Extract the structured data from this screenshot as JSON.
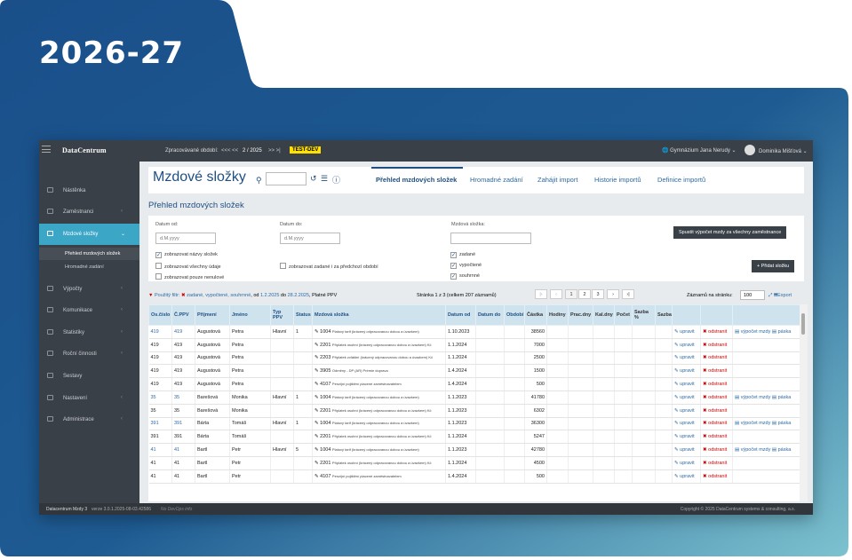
{
  "banner": {
    "year": "2026-27"
  },
  "colors": {
    "accent": "#3ca6c6",
    "brand": "#1f4f82",
    "topbar": "#3a4047",
    "badge": "#ffe000"
  },
  "topbar": {
    "logo": "DataCentrum",
    "period_label": "Zpracovávané období:",
    "period_nav_prev": "<<<  <<",
    "period_value": "2  /  2025",
    "period_nav_next": ">>  >|",
    "test_badge": "TEST-DEV",
    "school": "Gymnázium Jana Nerudy",
    "user": "Dominika Mišťová"
  },
  "sidebar": {
    "items": [
      {
        "label": "Nástěnka",
        "icon": "home-icon"
      },
      {
        "label": "Zaměstnanci",
        "icon": "users-icon"
      },
      {
        "label": "Mzdové složky",
        "icon": "card-icon"
      },
      {
        "label": "Výpočty",
        "icon": "calculator-icon"
      },
      {
        "label": "Komunikace",
        "icon": "share-icon"
      },
      {
        "label": "Statistiky",
        "icon": "chart-icon"
      },
      {
        "label": "Roční činnosti",
        "icon": "calendar-icon"
      },
      {
        "label": "Sestavy",
        "icon": "gear-icon"
      },
      {
        "label": "Nastavení",
        "icon": "settings-icon"
      },
      {
        "label": "Administrace",
        "icon": "admin-icon"
      }
    ],
    "sub": [
      "Přehled mzdových složek",
      "Hromadné zadání"
    ]
  },
  "header": {
    "title": "Mzdové složky",
    "tabs": [
      "Přehled mzdových složek",
      "Hromadné zadání",
      "Zahájit import",
      "Historie importů",
      "Definice importů"
    ]
  },
  "section_title": "Přehled mzdových složek",
  "filters": {
    "date_from_label": "Datum od:",
    "date_from_placeholder": "d.M.yyyy",
    "date_to_label": "Datum do:",
    "date_to_placeholder": "d.M.yyyy",
    "component_label": "Mzdová složka:",
    "checkboxes_left": [
      {
        "label": "zobrazovat názvy složek",
        "checked": true
      },
      {
        "label": "zobrazovat všechny údaje",
        "checked": false
      },
      {
        "label": "zobrazovat pouze nenulové",
        "checked": false
      }
    ],
    "checkbox_mid": {
      "label": "zobrazovat zadané i za předchozí období",
      "checked": false
    },
    "checkboxes_right": [
      {
        "label": "zadané",
        "checked": true
      },
      {
        "label": "vypočtené",
        "checked": true
      },
      {
        "label": "souhrnné",
        "checked": true
      }
    ],
    "calc_button": "Spustit výpočet mzdy za všechny zaměstnance",
    "add_button": "+ Přidat složku"
  },
  "bar": {
    "filter_label": "Použitý filtr:",
    "filter_values": "zadané, vypočtené, souhrnné",
    "filter_from": ", od ",
    "date_from": "1.2.2025",
    "filter_to": " do ",
    "date_to": "28.2.2025",
    "filter_tail": ", Platné PPV",
    "page_info": "Stránka 1 z 3 (celkem 207 záznamů)",
    "pages": [
      "1",
      "2",
      "3"
    ],
    "per_page_label": "Záznamů na stránku:",
    "per_page_value": "100",
    "export": "Export"
  },
  "table": {
    "columns": [
      "Os.číslo",
      "Č.PPV",
      "Příjmení",
      "Jméno",
      "Typ PPV",
      "Status",
      "Mzdová složka",
      "Datum od",
      "Datum do",
      "Období",
      "Částka",
      "Hodiny",
      "Prac.dny",
      "Kal.dny",
      "Počet",
      "Sazba %",
      "Sazba",
      "",
      "",
      ""
    ],
    "actions": {
      "edit": "upravit",
      "delete": "odstranit",
      "calc": "výpočet mzdy",
      "slip": "páska"
    },
    "rows": [
      {
        "os": "419",
        "ppv": "419",
        "surname": "Augustová",
        "name": "Petra",
        "type": "Hlavní",
        "status": "1",
        "code": "1004",
        "desc": "Platový tarif (krácený odpracovanou dobou a úvazkem)",
        "from": "1.10.2023",
        "amount": "38560",
        "main": true
      },
      {
        "os": "419",
        "ppv": "419",
        "surname": "Augustová",
        "name": "Petra",
        "type": "",
        "status": "",
        "code": "2201",
        "desc": "Příplatek osobní (krácený odpracovanou dobou a úvazkem) Kč",
        "from": "1.1.2024",
        "amount": "7000",
        "main": false
      },
      {
        "os": "419",
        "ppv": "419",
        "surname": "Augustová",
        "name": "Petra",
        "type": "",
        "status": "",
        "code": "2203",
        "desc": "Příplatek zvláštní (krácený odpracovanou dobou a úvazkem) Kč",
        "from": "1.1.2024",
        "amount": "2500",
        "main": false
      },
      {
        "os": "419",
        "ppv": "419",
        "surname": "Augustová",
        "name": "Petra",
        "type": "",
        "status": "",
        "code": "3905",
        "desc": "Odměny - DP (AR) Prémie doprava",
        "from": "1.4.2024",
        "amount": "1500",
        "main": false
      },
      {
        "os": "419",
        "ppv": "419",
        "surname": "Augustová",
        "name": "Petra",
        "type": "",
        "status": "",
        "code": "4107",
        "desc": "Penzijní pojištění placené zaměstnavatelem",
        "from": "1.4.2024",
        "amount": "500",
        "main": false
      },
      {
        "os": "35",
        "ppv": "35",
        "surname": "Barešová",
        "name": "Monika",
        "type": "Hlavní",
        "status": "1",
        "code": "1004",
        "desc": "Platový tarif (krácený odpracovanou dobou a úvazkem)",
        "from": "1.1.2023",
        "amount": "41780",
        "main": true
      },
      {
        "os": "35",
        "ppv": "35",
        "surname": "Barešová",
        "name": "Monika",
        "type": "",
        "status": "",
        "code": "2201",
        "desc": "Příplatek osobní (krácený odpracovanou dobou a úvazkem) Kč",
        "from": "1.1.2023",
        "amount": "6302",
        "main": false
      },
      {
        "os": "391",
        "ppv": "391",
        "surname": "Bárta",
        "name": "Tomáš",
        "type": "Hlavní",
        "status": "1",
        "code": "1004",
        "desc": "Platový tarif (krácený odpracovanou dobou a úvazkem)",
        "from": "1.1.2023",
        "amount": "36300",
        "main": true
      },
      {
        "os": "391",
        "ppv": "391",
        "surname": "Bárta",
        "name": "Tomáš",
        "type": "",
        "status": "",
        "code": "2201",
        "desc": "Příplatek osobní (krácený odpracovanou dobou a úvazkem) Kč",
        "from": "1.1.2024",
        "amount": "5247",
        "main": false
      },
      {
        "os": "41",
        "ppv": "41",
        "surname": "Bartl",
        "name": "Petr",
        "type": "Hlavní",
        "status": "5",
        "code": "1004",
        "desc": "Platový tarif (krácený odpracovanou dobou a úvazkem)",
        "from": "1.1.2023",
        "amount": "42780",
        "main": true
      },
      {
        "os": "41",
        "ppv": "41",
        "surname": "Bartl",
        "name": "Petr",
        "type": "",
        "status": "",
        "code": "2201",
        "desc": "Příplatek osobní (krácený odpracovanou dobou a úvazkem) Kč",
        "from": "1.1.2024",
        "amount": "4500",
        "main": false
      },
      {
        "os": "41",
        "ppv": "41",
        "surname": "Bartl",
        "name": "Petr",
        "type": "",
        "status": "",
        "code": "4107",
        "desc": "Penzijní pojištění placené zaměstnavatelem",
        "from": "1.4.2024",
        "amount": "500",
        "main": false
      }
    ]
  },
  "footer": {
    "left": "Datacentrum Mzdy 3",
    "version": "verze   3.0.1.2025-08-03.42586",
    "devinfo": "No DevOps info",
    "right": "Copyright © 2025 DataCentrum systems & consulting, a.s."
  }
}
